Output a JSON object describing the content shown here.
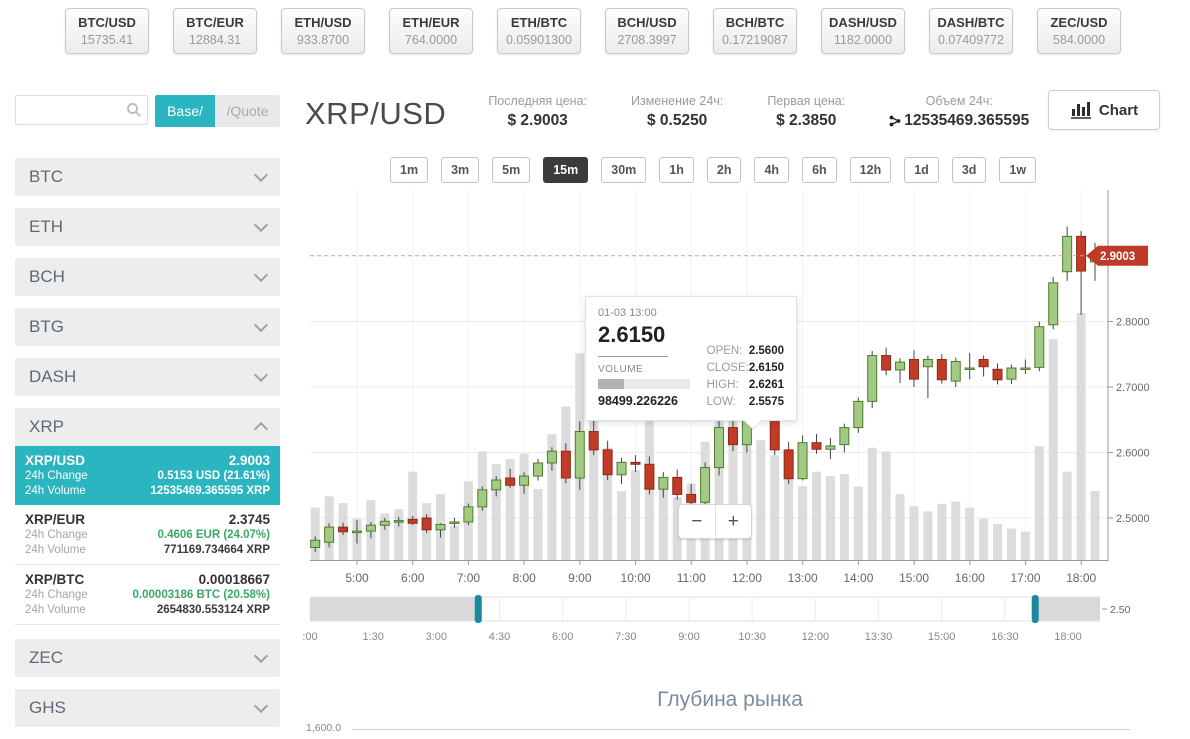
{
  "tickers": [
    {
      "symbol": "BTC/USD",
      "value": "15735.41"
    },
    {
      "symbol": "BTC/EUR",
      "value": "12884.31"
    },
    {
      "symbol": "ETH/USD",
      "value": "933.8700"
    },
    {
      "symbol": "ETH/EUR",
      "value": "764.0000"
    },
    {
      "symbol": "ETH/BTC",
      "value": "0.05901300"
    },
    {
      "symbol": "BCH/USD",
      "value": "2708.3997"
    },
    {
      "symbol": "BCH/BTC",
      "value": "0.17219087"
    },
    {
      "symbol": "DASH/USD",
      "value": "1182.0000"
    },
    {
      "symbol": "DASH/BTC",
      "value": "0.07409772"
    },
    {
      "symbol": "ZEC/USD",
      "value": "584.0000"
    }
  ],
  "sidebar": {
    "search_placeholder": "",
    "base_label": "Base/",
    "quote_label": "/Quote",
    "change_label": "24h Change",
    "volume_label": "24h Volume",
    "groups": [
      {
        "label": "BTC",
        "expanded": false
      },
      {
        "label": "ETH",
        "expanded": false
      },
      {
        "label": "BCH",
        "expanded": false
      },
      {
        "label": "BTG",
        "expanded": false
      },
      {
        "label": "DASH",
        "expanded": false
      },
      {
        "label": "XRP",
        "expanded": true,
        "pairs": [
          {
            "name": "XRP/USD",
            "price": "2.9003",
            "change": "0.5153 USD (21.61%)",
            "change_green": false,
            "volume": "12535469.365595 XRP",
            "selected": true
          },
          {
            "name": "XRP/EUR",
            "price": "2.3745",
            "change": "0.4606 EUR (24.07%)",
            "change_green": true,
            "volume": "771169.734664 XRP",
            "selected": false
          },
          {
            "name": "XRP/BTC",
            "price": "0.00018667",
            "change": "0.00003186 BTC (20.58%)",
            "change_green": true,
            "volume": "2654830.553124 XRP",
            "selected": false
          }
        ]
      },
      {
        "label": "ZEC",
        "expanded": false
      },
      {
        "label": "GHS",
        "expanded": false
      }
    ]
  },
  "main": {
    "pair_title": "XRP/USD",
    "stats": [
      {
        "label": "Последняя цена:",
        "value": "$ 2.9003",
        "icon": null
      },
      {
        "label": "Изменение 24ч:",
        "value": "$ 0.5250",
        "icon": null
      },
      {
        "label": "Первая цена:",
        "value": "$ 2.3850",
        "icon": null
      },
      {
        "label": "Объем 24ч:",
        "value": "12535469.365595",
        "icon": "xrp-icon"
      }
    ],
    "chart_button": "Chart",
    "timeframes": [
      "1m",
      "3m",
      "5m",
      "15m",
      "30m",
      "1h",
      "2h",
      "4h",
      "6h",
      "12h",
      "1d",
      "3d",
      "1w"
    ],
    "selected_timeframe": "15m",
    "zoom_out": "−",
    "zoom_in": "+",
    "depth_title": "Глубина рынка",
    "depth_axis_label": "1,600.0"
  },
  "chart_data": {
    "type": "candlestick",
    "pair": "XRP/USD",
    "interval": "15m",
    "last_price": 2.9003,
    "last_price_label": "2.9003",
    "y_ticks": [
      2.5,
      2.6,
      2.7,
      2.8
    ],
    "x_labels": [
      "5:00",
      "6:00",
      "7:00",
      "8:00",
      "9:00",
      "10:00",
      "11:00",
      "12:00",
      "13:00",
      "14:00",
      "15:00",
      "16:00",
      "17:00",
      "18:00"
    ],
    "nav_labels": [
      ":00",
      "1:30",
      "3:00",
      "4:30",
      "6:00",
      "7:30",
      "9:00",
      "10:30",
      "12:00",
      "13:30",
      "15:00",
      "16:30",
      "18:00"
    ],
    "nav_right_label": "2.50",
    "nav_window": {
      "start_frac": 0.213,
      "end_frac": 0.918
    },
    "candle_format": [
      "time",
      "open",
      "high",
      "low",
      "close",
      "volume"
    ],
    "candles": [
      [
        "04:15",
        2.455,
        2.472,
        2.448,
        2.466,
        70000
      ],
      [
        "04:30",
        2.463,
        2.492,
        2.455,
        2.486,
        85000
      ],
      [
        "04:45",
        2.486,
        2.493,
        2.474,
        2.479,
        76000
      ],
      [
        "05:00",
        2.479,
        2.497,
        2.461,
        2.48,
        55000
      ],
      [
        "05:15",
        2.48,
        2.494,
        2.469,
        2.489,
        80000
      ],
      [
        "05:30",
        2.489,
        2.5,
        2.482,
        2.495,
        62000
      ],
      [
        "05:45",
        2.495,
        2.502,
        2.487,
        2.496,
        68000
      ],
      [
        "06:00",
        2.498,
        2.503,
        2.489,
        2.492,
        118000
      ],
      [
        "06:15",
        2.5,
        2.506,
        2.477,
        2.482,
        76000
      ],
      [
        "06:30",
        2.482,
        2.492,
        2.47,
        2.49,
        88000
      ],
      [
        "06:45",
        2.492,
        2.5,
        2.485,
        2.494,
        46000
      ],
      [
        "07:00",
        2.494,
        2.522,
        2.489,
        2.517,
        105000
      ],
      [
        "07:15",
        2.517,
        2.548,
        2.511,
        2.543,
        145000
      ],
      [
        "07:30",
        2.543,
        2.564,
        2.533,
        2.558,
        128000
      ],
      [
        "07:45",
        2.561,
        2.575,
        2.546,
        2.55,
        135000
      ],
      [
        "08:00",
        2.55,
        2.57,
        2.537,
        2.564,
        142000
      ],
      [
        "08:15",
        2.564,
        2.59,
        2.557,
        2.584,
        95000
      ],
      [
        "08:30",
        2.584,
        2.608,
        2.572,
        2.602,
        168000
      ],
      [
        "08:45",
        2.602,
        2.614,
        2.553,
        2.561,
        205000
      ],
      [
        "09:00",
        2.561,
        2.648,
        2.543,
        2.632,
        276000
      ],
      [
        "09:15",
        2.632,
        2.655,
        2.596,
        2.604,
        235000
      ],
      [
        "09:30",
        2.604,
        2.618,
        2.558,
        2.566,
        150000
      ],
      [
        "09:45",
        2.566,
        2.592,
        2.552,
        2.585,
        92000
      ],
      [
        "10:00",
        2.585,
        2.596,
        2.57,
        2.582,
        120000
      ],
      [
        "10:15",
        2.582,
        2.594,
        2.536,
        2.544,
        188000
      ],
      [
        "10:30",
        2.544,
        2.57,
        2.531,
        2.562,
        96000
      ],
      [
        "10:45",
        2.562,
        2.574,
        2.528,
        2.536,
        84000
      ],
      [
        "11:00",
        2.536,
        2.552,
        2.518,
        2.524,
        102000
      ],
      [
        "11:15",
        2.524,
        2.585,
        2.515,
        2.577,
        158000
      ],
      [
        "11:30",
        2.577,
        2.648,
        2.565,
        2.638,
        245000
      ],
      [
        "11:45",
        2.638,
        2.652,
        2.602,
        2.612,
        190000
      ],
      [
        "12:00",
        2.612,
        2.672,
        2.6,
        2.66,
        240000
      ],
      [
        "12:15",
        2.66,
        2.7,
        2.648,
        2.668,
        160000
      ],
      [
        "12:30",
        2.668,
        2.676,
        2.596,
        2.604,
        140000
      ],
      [
        "12:45",
        2.604,
        2.616,
        2.552,
        2.56,
        125000
      ],
      [
        "13:00",
        2.56,
        2.6261,
        2.5575,
        2.615,
        98499
      ],
      [
        "13:15",
        2.615,
        2.628,
        2.598,
        2.605,
        118000
      ],
      [
        "13:30",
        2.605,
        2.622,
        2.59,
        2.61,
        112000
      ],
      [
        "13:45",
        2.612,
        2.644,
        2.6,
        2.638,
        115000
      ],
      [
        "14:00",
        2.638,
        2.684,
        2.63,
        2.678,
        98000
      ],
      [
        "14:15",
        2.678,
        2.755,
        2.668,
        2.748,
        150000
      ],
      [
        "14:30",
        2.748,
        2.76,
        2.718,
        2.726,
        145000
      ],
      [
        "14:45",
        2.726,
        2.744,
        2.706,
        2.738,
        88000
      ],
      [
        "15:00",
        2.742,
        2.756,
        2.7,
        2.712,
        72000
      ],
      [
        "15:15",
        2.731,
        2.748,
        2.683,
        2.742,
        65000
      ],
      [
        "15:30",
        2.742,
        2.75,
        2.705,
        2.711,
        75000
      ],
      [
        "15:45",
        2.709,
        2.745,
        2.7,
        2.739,
        78000
      ],
      [
        "16:00",
        2.729,
        2.752,
        2.712,
        2.729,
        70000
      ],
      [
        "16:15",
        2.742,
        2.748,
        2.716,
        2.731,
        55000
      ],
      [
        "16:30",
        2.727,
        2.736,
        2.704,
        2.711,
        48000
      ],
      [
        "16:45",
        2.712,
        2.734,
        2.705,
        2.729,
        42000
      ],
      [
        "17:00",
        2.728,
        2.742,
        2.72,
        2.729,
        38000
      ],
      [
        "17:15",
        2.73,
        2.8,
        2.724,
        2.792,
        152000
      ],
      [
        "17:30",
        2.795,
        2.868,
        2.788,
        2.859,
        295000
      ],
      [
        "17:45",
        2.876,
        2.945,
        2.862,
        2.93,
        118000
      ],
      [
        "18:00",
        2.93,
        2.938,
        2.81,
        2.877,
        330000
      ],
      [
        "18:15",
        2.891,
        2.92,
        2.862,
        2.9003,
        92000
      ]
    ],
    "tooltip": {
      "date": "01-03 13:00",
      "price": "2.6150",
      "volume_label": "VOLUME",
      "volume": "98499.226226",
      "rows": [
        {
          "label": "OPEN:",
          "value": "2.5600"
        },
        {
          "label": "CLOSE:",
          "value": "2.6150"
        },
        {
          "label": "HIGH:",
          "value": "2.6261"
        },
        {
          "label": "LOW:",
          "value": "2.5575"
        }
      ]
    },
    "colors": {
      "up": "#a3ca85",
      "up_border": "#4c7d2b",
      "down": "#c13b26",
      "down_border": "#8e2a18",
      "volume": "#dcdcdc",
      "badge": "#bf3b27",
      "dashed_line": "#e09a8c",
      "handle": "#1d87a0",
      "accent_teal": "#2ab5c0",
      "green_text": "#3aa864"
    }
  }
}
